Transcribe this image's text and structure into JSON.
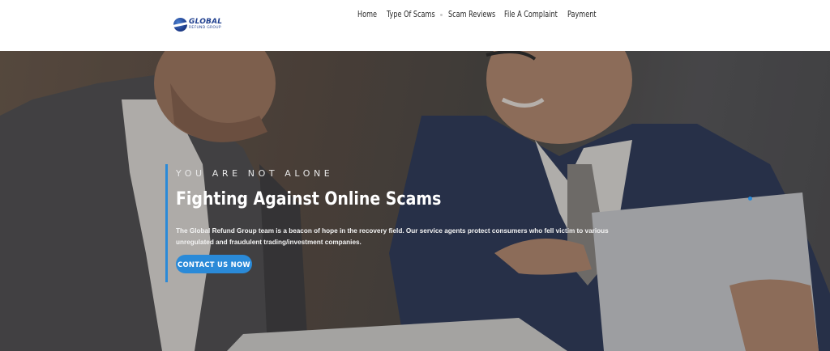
{
  "header": {
    "logo": {
      "main": "GLOBAL",
      "sub": "REFUND GROUP"
    },
    "nav": [
      {
        "label": "Home"
      },
      {
        "label": "Type Of Scams"
      },
      {
        "label": "Scam Reviews"
      },
      {
        "label": "File A Complaint"
      },
      {
        "label": "Payment"
      }
    ]
  },
  "hero": {
    "eyebrow": "YOU ARE NOT ALONE",
    "title": "Fighting Against Online Scams",
    "description": "The Global Refund Group team is a beacon of hope in the recovery field. Our service agents protect consumers who fell victim to various unregulated and fraudulent trading/investment companies.",
    "cta_label": "CONTACT US NOW"
  },
  "colors": {
    "accent": "#2a8ad8",
    "logo_blue": "#1f3f8f",
    "nav_text": "#2a2a2a"
  }
}
